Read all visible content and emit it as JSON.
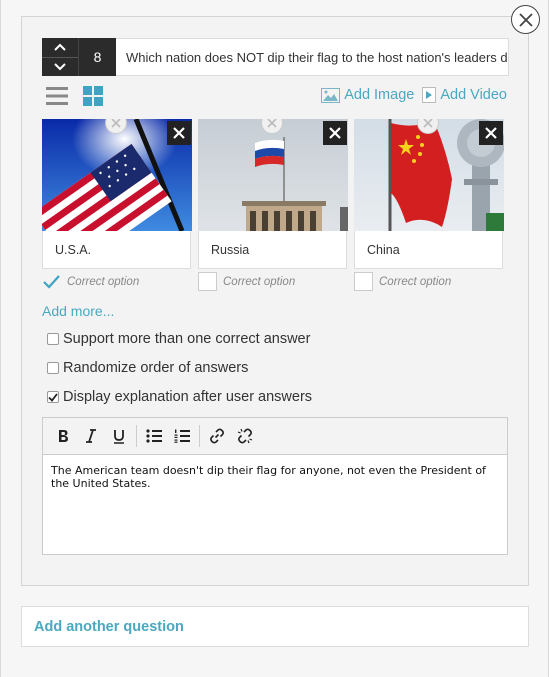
{
  "question": {
    "number": "8",
    "text": "Which nation does NOT dip their flag to the host nation's leaders d"
  },
  "media": {
    "add_image_label": "Add Image",
    "add_video_label": "Add Video"
  },
  "options": [
    {
      "label": "U.S.A.",
      "correct_label": "Correct option",
      "correct": true,
      "image": "usa-flag-image"
    },
    {
      "label": "Russia",
      "correct_label": "Correct option",
      "correct": false,
      "image": "russia-flag-image"
    },
    {
      "label": "China",
      "correct_label": "Correct option",
      "correct": false,
      "image": "china-flag-image"
    }
  ],
  "add_more_label": "Add more...",
  "settings": [
    {
      "label": "Support more than one correct answer",
      "checked": false
    },
    {
      "label": "Randomize order of answers",
      "checked": false
    },
    {
      "label": "Display explanation after user answers",
      "checked": true
    }
  ],
  "editor": {
    "toolbar": [
      "bold-icon",
      "italic-icon",
      "underline-icon",
      "bulleted-list-icon",
      "numbered-list-icon",
      "link-icon",
      "unlink-icon"
    ],
    "content": "The American team doesn't dip their flag for anyone, not even the President of the United States."
  },
  "add_question_label": "Add another question",
  "colors": {
    "accent": "#4aa8c0",
    "dark": "#2b2b2b"
  }
}
